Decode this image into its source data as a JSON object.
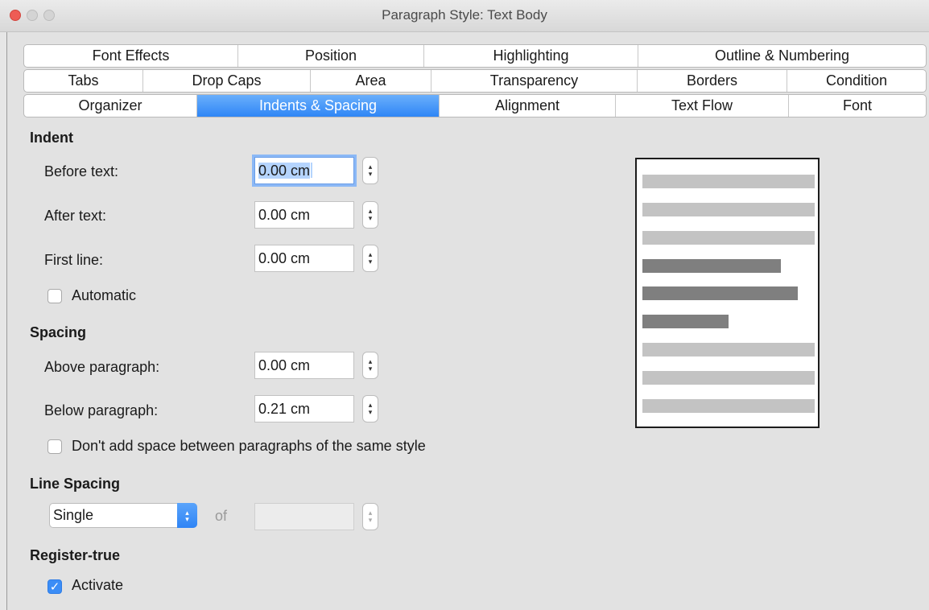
{
  "window": {
    "title": "Paragraph Style: Text Body"
  },
  "tabs": {
    "row1": [
      "Font Effects",
      "Position",
      "Highlighting",
      "Outline & Numbering"
    ],
    "row2": [
      "Tabs",
      "Drop Caps",
      "Area",
      "Transparency",
      "Borders",
      "Condition"
    ],
    "row3": [
      "Organizer",
      "Indents & Spacing",
      "Alignment",
      "Text Flow",
      "Font"
    ],
    "active": "Indents & Spacing"
  },
  "indent": {
    "heading": "Indent",
    "before_label": "Before text:",
    "before_value": "0.00 cm",
    "after_label": "After text:",
    "after_value": "0.00 cm",
    "first_label": "First line:",
    "first_value": "0.00 cm",
    "automatic_label": "Automatic",
    "automatic_checked": false
  },
  "spacing": {
    "heading": "Spacing",
    "above_label": "Above paragraph:",
    "above_value": "0.00 cm",
    "below_label": "Below paragraph:",
    "below_value": "0.21 cm",
    "no_space_label": "Don't add space between paragraphs of the same style",
    "no_space_checked": false
  },
  "line_spacing": {
    "heading": "Line Spacing",
    "selected": "Single",
    "of_label": "of",
    "of_value": ""
  },
  "register_true": {
    "heading": "Register-true",
    "activate_label": "Activate",
    "activate_checked": true
  },
  "colors": {
    "accent": "#2f86f6",
    "preview_other_lines": "#c3c3c3",
    "preview_current_lines": "#7f7f7f"
  }
}
